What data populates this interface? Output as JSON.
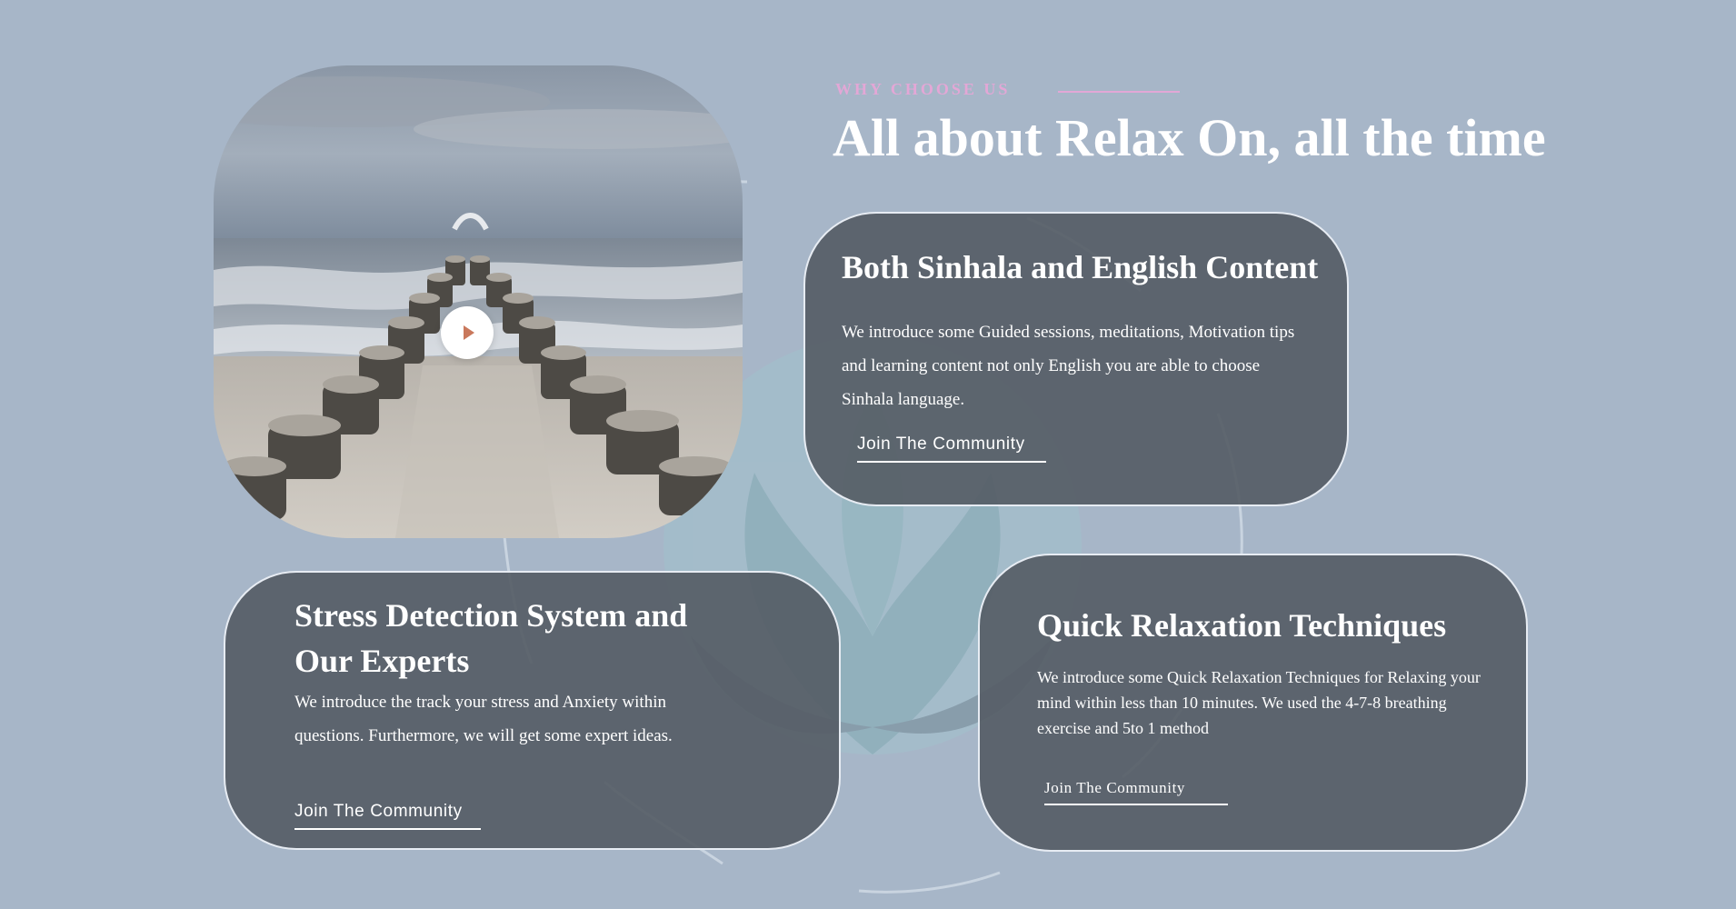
{
  "section": {
    "eyebrow": "WHY CHOOSE US",
    "headline": "All about Relax On, all the time"
  },
  "hero": {
    "image_alt": "Wooden groynes leading into a stormy sea",
    "play_icon": "play-icon"
  },
  "cards": [
    {
      "title": "Both Sinhala and English Content",
      "text": "We introduce some Guided sessions, meditations, Motivation tips and learning content not only English you are able to choose Sinhala language.",
      "link_label": "Join The Community"
    },
    {
      "title": "Stress Detection System and Our Experts",
      "text": "We introduce the track your stress and Anxiety within questions. Furthermore, we will get some expert ideas.",
      "link_label": "Join The Community"
    },
    {
      "title": "Quick Relaxation Techniques",
      "text": "We introduce some Quick Relaxation Techniques for Relaxing your mind within less than 10 minutes. We used the 4-7-8 breathing exercise and 5to 1 method",
      "link_label": "Join The Community"
    }
  ],
  "colors": {
    "background": "#a7b6c8",
    "eyebrow": "#e3a7d6",
    "card": "#565d66",
    "card_border": "#e7ecf3",
    "play_accent": "#c9785c"
  }
}
